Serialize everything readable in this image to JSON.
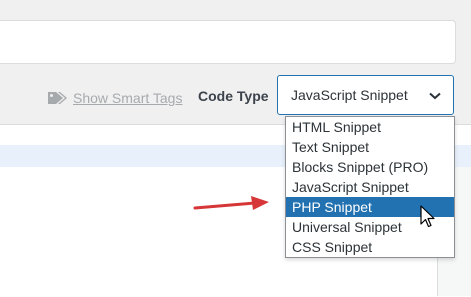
{
  "toolbar": {
    "smart_tags_label": "Show Smart Tags",
    "smart_tags_icon": "tag-icon",
    "code_type_label": "Code Type"
  },
  "code_type_select": {
    "value": "JavaScript Snippet",
    "chevron_icon": "chevron-down-icon",
    "options": [
      "HTML Snippet",
      "Text Snippet",
      "Blocks Snippet (PRO)",
      "JavaScript Snippet",
      "PHP Snippet",
      "Universal Snippet",
      "CSS Snippet"
    ],
    "highlighted_option": "PHP Snippet"
  },
  "annotation": {
    "arrow_icon": "red-arrow-icon",
    "arrow_color": "#d63638"
  },
  "colors": {
    "accent": "#2271b1",
    "highlight_strip": "#e8f0fc"
  }
}
